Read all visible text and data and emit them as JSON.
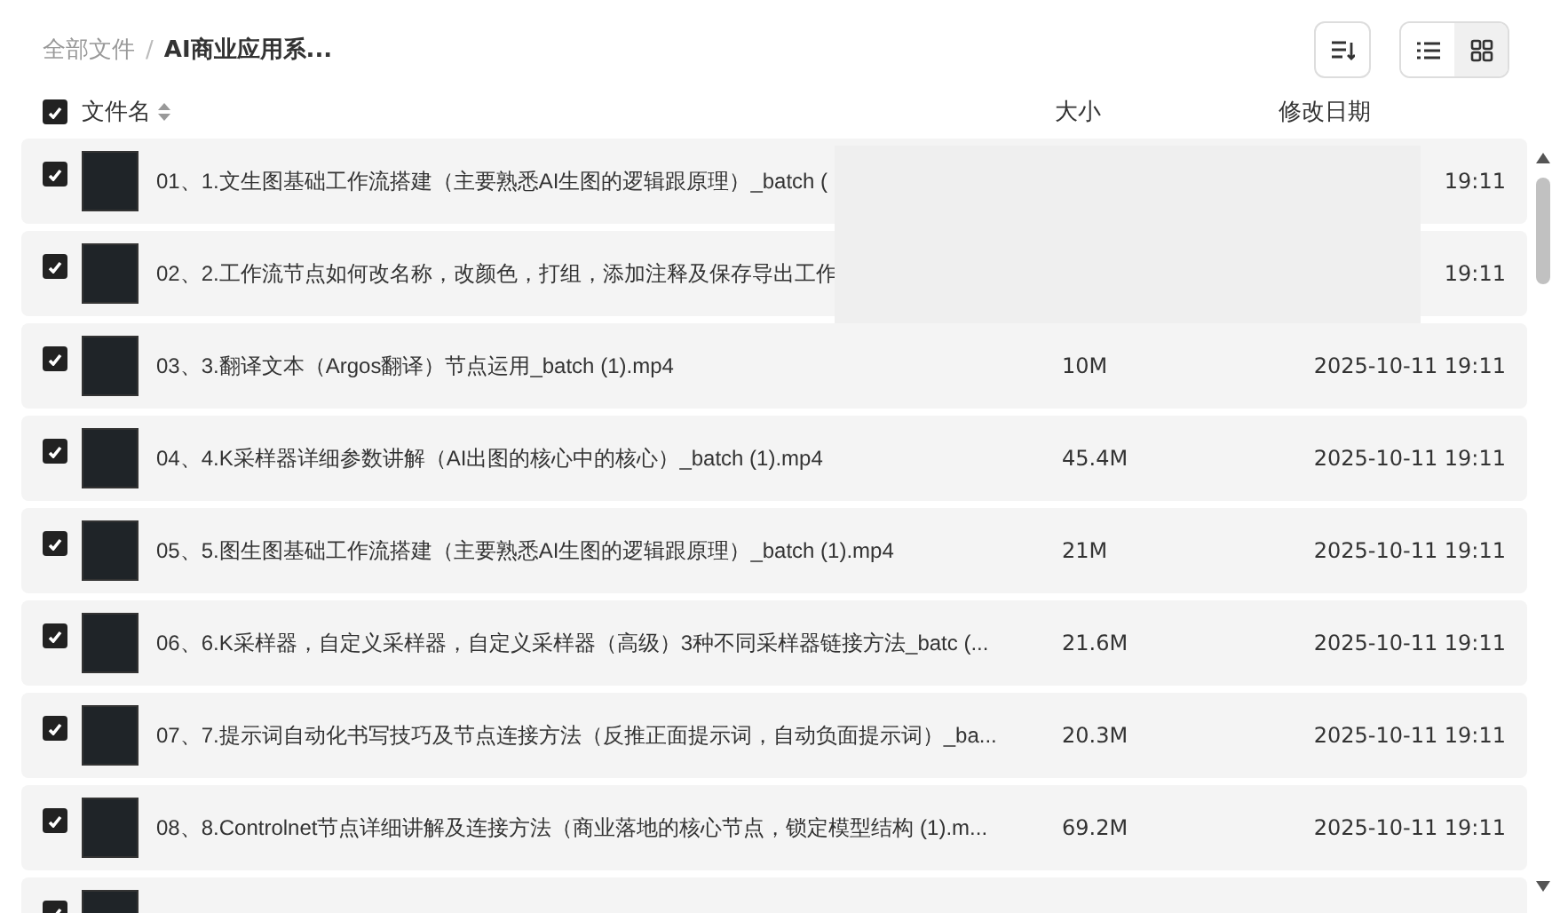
{
  "breadcrumb": [
    {
      "label": "全部文件",
      "current": false
    },
    {
      "label": "AI商业应用系...",
      "current": true
    }
  ],
  "breadcrumb_separator": "/",
  "view_modes": [
    {
      "kind": "list",
      "selected": false
    },
    {
      "kind": "grid",
      "selected": true
    }
  ],
  "header": {
    "select_all": true,
    "name": "文件名",
    "size": "大小",
    "date": "修改日期"
  },
  "files": [
    {
      "checked": true,
      "name": "01、1.文生图基础工作流搭建（主要熟悉AI生图的逻辑跟原理）_batch (",
      "date": "19:11"
    },
    {
      "checked": true,
      "name": "02、2.工作流节点如何改名称，改颜色，打组，添加注释及保存导出工作",
      "date": "19:11"
    },
    {
      "checked": true,
      "name": "03、3.翻译文本（Argos翻译）节点运用_batch (1).mp4",
      "size": "10M",
      "date": "2025-10-11 19:11"
    },
    {
      "checked": true,
      "name": "04、4.K采样器详细参数讲解（AI出图的核心中的核心）_batch (1).mp4",
      "size": "45.4M",
      "date": "2025-10-11 19:11"
    },
    {
      "checked": true,
      "name": "05、5.图生图基础工作流搭建（主要熟悉AI生图的逻辑跟原理）_batch (1).mp4",
      "size": "21M",
      "date": "2025-10-11 19:11"
    },
    {
      "checked": true,
      "name": "06、6.K采样器，自定义采样器，自定义采样器（高级）3种不同采样器链接方法_batc (...",
      "size": "21.6M",
      "date": "2025-10-11 19:11"
    },
    {
      "checked": true,
      "name": "07、7.提示词自动化书写技巧及节点连接方法（反推正面提示词，自动负面提示词）_ba...",
      "size": "20.3M",
      "date": "2025-10-11 19:11"
    },
    {
      "checked": true,
      "name": "08、8.Controlnet节点详细讲解及连接方法（商业落地的核心节点，锁定模型结构 (1).m...",
      "size": "69.2M",
      "date": "2025-10-11 19:11"
    },
    {
      "checked": true
    }
  ]
}
